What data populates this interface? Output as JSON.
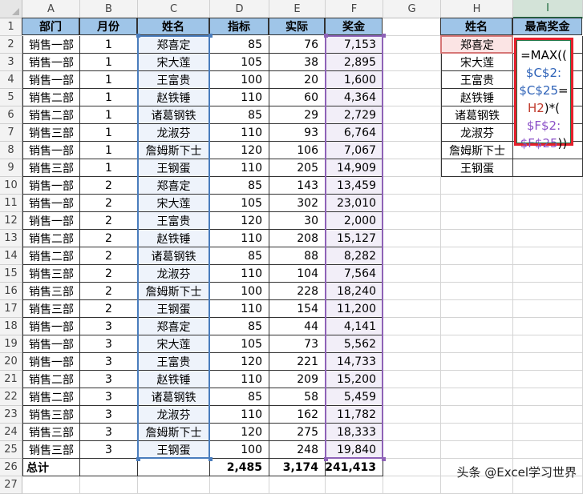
{
  "columns": [
    "A",
    "B",
    "C",
    "D",
    "E",
    "F",
    "G",
    "H",
    "I"
  ],
  "headers": [
    "部门",
    "月份",
    "姓名",
    "指标",
    "实际",
    "奖金"
  ],
  "rows": [
    [
      "销售一部",
      "1",
      "郑喜定",
      "85",
      "76",
      "7,153"
    ],
    [
      "销售一部",
      "1",
      "宋大莲",
      "105",
      "38",
      "2,895"
    ],
    [
      "销售一部",
      "1",
      "王富贵",
      "100",
      "20",
      "1,600"
    ],
    [
      "销售二部",
      "1",
      "赵铁锤",
      "110",
      "60",
      "4,364"
    ],
    [
      "销售二部",
      "1",
      "诸葛钢铁",
      "85",
      "29",
      "2,729"
    ],
    [
      "销售三部",
      "1",
      "龙淑芬",
      "110",
      "93",
      "6,764"
    ],
    [
      "销售一部",
      "1",
      "詹姆斯下士",
      "120",
      "106",
      "7,067"
    ],
    [
      "销售三部",
      "1",
      "王钢蛋",
      "110",
      "205",
      "14,909"
    ],
    [
      "销售一部",
      "2",
      "郑喜定",
      "85",
      "143",
      "13,459"
    ],
    [
      "销售一部",
      "2",
      "宋大莲",
      "105",
      "302",
      "23,010"
    ],
    [
      "销售一部",
      "2",
      "王富贵",
      "120",
      "30",
      "2,000"
    ],
    [
      "销售二部",
      "2",
      "赵铁锤",
      "110",
      "208",
      "15,127"
    ],
    [
      "销售二部",
      "2",
      "诸葛钢铁",
      "85",
      "88",
      "8,282"
    ],
    [
      "销售三部",
      "2",
      "龙淑芬",
      "110",
      "104",
      "7,564"
    ],
    [
      "销售三部",
      "2",
      "詹姆斯下士",
      "100",
      "228",
      "18,240"
    ],
    [
      "销售三部",
      "2",
      "王钢蛋",
      "110",
      "154",
      "11,200"
    ],
    [
      "销售一部",
      "3",
      "郑喜定",
      "85",
      "44",
      "4,141"
    ],
    [
      "销售一部",
      "3",
      "宋大莲",
      "105",
      "73",
      "5,562"
    ],
    [
      "销售一部",
      "3",
      "王富贵",
      "120",
      "221",
      "14,733"
    ],
    [
      "销售二部",
      "3",
      "赵铁锤",
      "110",
      "209",
      "15,200"
    ],
    [
      "销售二部",
      "3",
      "诸葛钢铁",
      "85",
      "58",
      "5,459"
    ],
    [
      "销售三部",
      "3",
      "龙淑芬",
      "110",
      "162",
      "11,782"
    ],
    [
      "销售三部",
      "3",
      "詹姆斯下士",
      "120",
      "275",
      "18,333"
    ],
    [
      "销售三部",
      "3",
      "王钢蛋",
      "100",
      "248",
      "19,840"
    ]
  ],
  "total": {
    "label": "总计",
    "target": "2,485",
    "actual": "3,174",
    "bonus": "241,413"
  },
  "side_table": {
    "headers": [
      "姓名",
      "最高奖金"
    ],
    "names": [
      "郑喜定",
      "宋大莲",
      "王富贵",
      "赵铁锤",
      "诸葛钢铁",
      "龙淑芬",
      "詹姆斯下士",
      "王钢蛋"
    ]
  },
  "formula": {
    "lines": [
      [
        "=MAX((",
        "$C$2:",
        "$C$25",
        "=",
        "H2)*(",
        "$F$2:",
        "$F$25))"
      ]
    ],
    "parts": [
      {
        "text": "=MAX((",
        "role": "base"
      },
      {
        "text": "$C$2:",
        "role": "ref-c"
      },
      {
        "text": "$C$25",
        "role": "ref-c"
      },
      {
        "text": "=",
        "role": "base"
      },
      {
        "text": "H2",
        "role": "ref-h"
      },
      {
        "text": ")*(",
        "role": "base"
      },
      {
        "text": "$F$2:",
        "role": "ref-f"
      },
      {
        "text": "$F$25",
        "role": "ref-f"
      },
      {
        "text": "))",
        "role": "base"
      }
    ]
  },
  "colors": {
    "header_fill": "#9fc5e8",
    "ref_c": "#2f63b8",
    "ref_f": "#8a4fc7",
    "ref_h": "#c0392b",
    "highlight_box": "#e51f2b"
  },
  "watermark": "头条 @Excel学习世界"
}
